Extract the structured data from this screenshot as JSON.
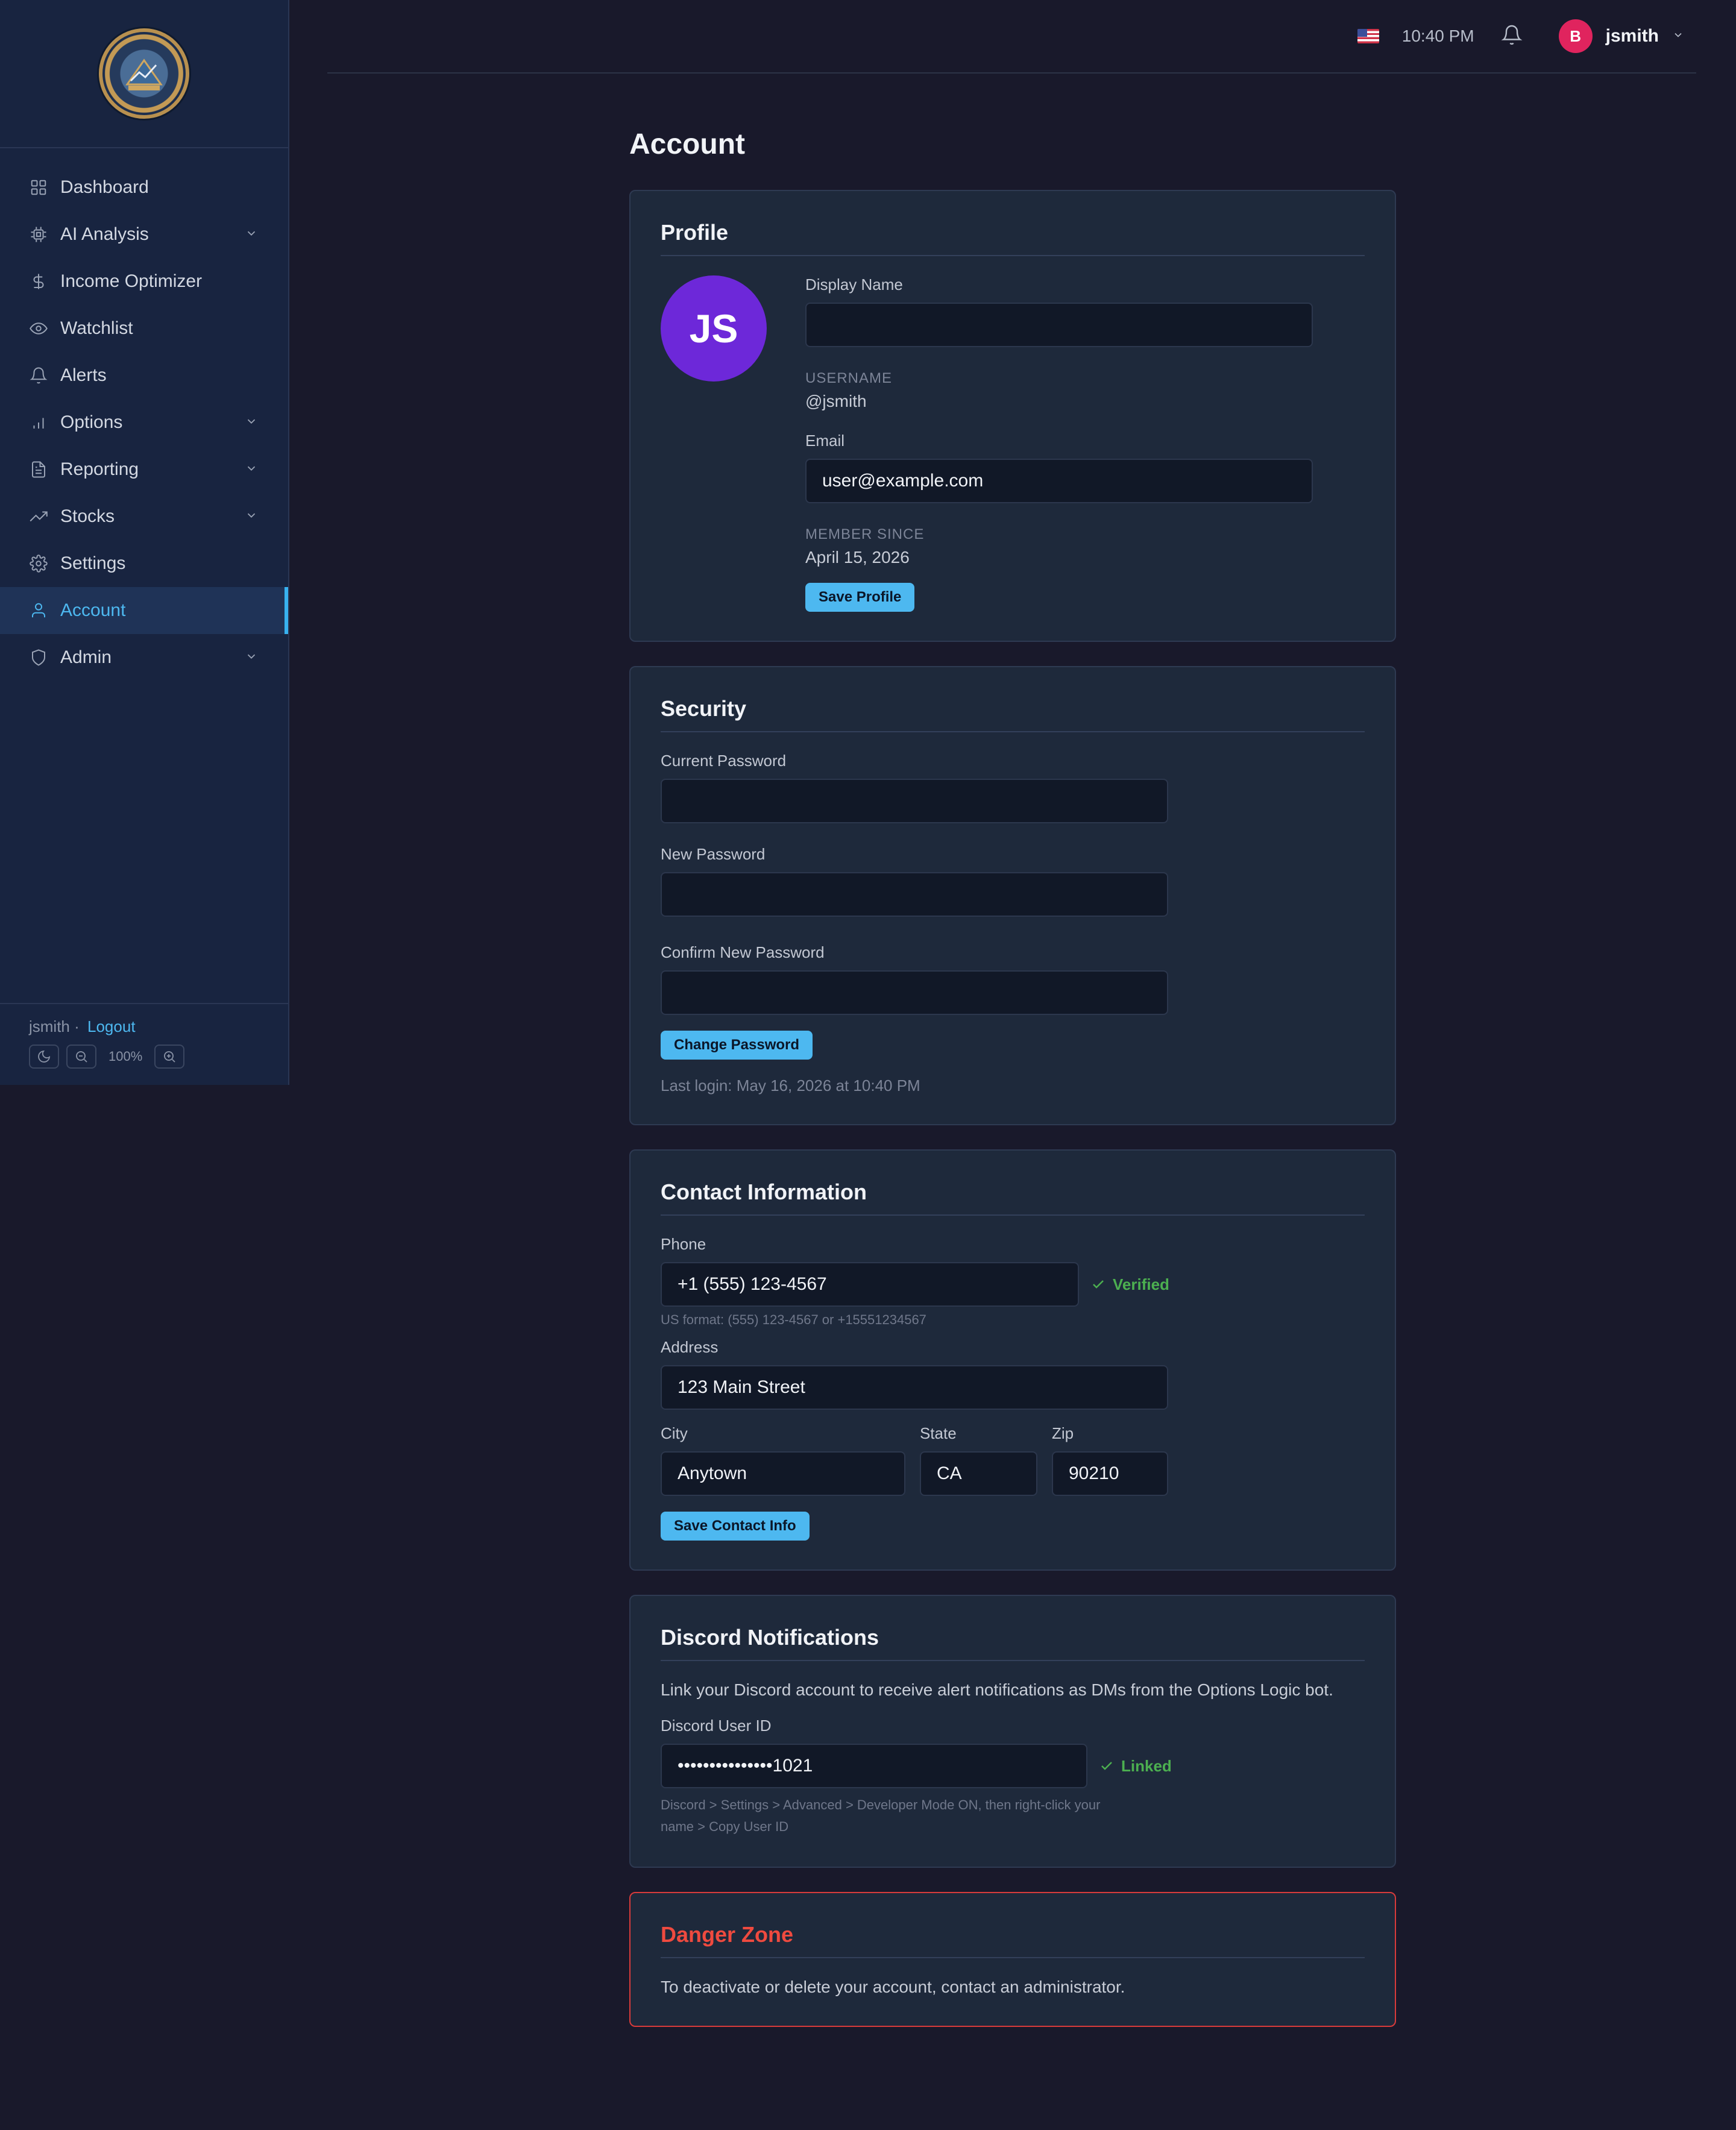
{
  "sidebar": {
    "logo_text": [
      "OPTIONS ANALYTICS PLATFORM",
      "OPTIONS LOGIC",
      "SECURE GROWTH"
    ],
    "items": [
      {
        "label": "Dashboard",
        "icon": "grid-icon",
        "has_children": false
      },
      {
        "label": "AI Analysis",
        "icon": "chip-icon",
        "has_children": true
      },
      {
        "label": "Income Optimizer",
        "icon": "dollar-icon",
        "has_children": false
      },
      {
        "label": "Watchlist",
        "icon": "eye-icon",
        "has_children": false
      },
      {
        "label": "Alerts",
        "icon": "bell-icon",
        "has_children": false
      },
      {
        "label": "Options",
        "icon": "bar-chart-icon",
        "has_children": true
      },
      {
        "label": "Reporting",
        "icon": "document-icon",
        "has_children": true
      },
      {
        "label": "Stocks",
        "icon": "trending-up-icon",
        "has_children": true
      },
      {
        "label": "Settings",
        "icon": "gear-icon",
        "has_children": false
      },
      {
        "label": "Account",
        "icon": "user-icon",
        "has_children": false,
        "active": true
      },
      {
        "label": "Admin",
        "icon": "shield-icon",
        "has_children": true
      }
    ],
    "footer": {
      "username": "jsmith ·",
      "logout_label": "Logout",
      "zoom": "100%"
    }
  },
  "topbar": {
    "time": "10:40 PM",
    "avatar_initial": "B",
    "username": "jsmith"
  },
  "page": {
    "title": "Account"
  },
  "profile": {
    "heading": "Profile",
    "avatar_initials": "JS",
    "display_name_label": "Display Name",
    "display_name_value": "",
    "username_label": "USERNAME",
    "username_value": "@jsmith",
    "email_label": "Email",
    "email_value": "user@example.com",
    "member_since_label": "MEMBER SINCE",
    "member_since_value": "April 15, 2026",
    "save_label": "Save Profile"
  },
  "security": {
    "heading": "Security",
    "current_password_label": "Current Password",
    "new_password_label": "New Password",
    "confirm_password_label": "Confirm New Password",
    "change_label": "Change Password",
    "last_login": "Last login: May 16, 2026 at 10:40 PM"
  },
  "contact": {
    "heading": "Contact Information",
    "phone_label": "Phone",
    "phone_value": "+1 (555) 123-4567",
    "phone_status": "Verified",
    "phone_hint": "US format: (555) 123-4567 or +15551234567",
    "address_label": "Address",
    "address_value": "123 Main Street",
    "city_label": "City",
    "city_value": "Anytown",
    "state_label": "State",
    "state_value": "CA",
    "zip_label": "Zip",
    "zip_value": "90210",
    "save_label": "Save Contact Info"
  },
  "discord": {
    "heading": "Discord Notifications",
    "description": "Link your Discord account to receive alert notifications as DMs from the Options Logic bot.",
    "user_id_label": "Discord User ID",
    "user_id_value": "•••••••••••••••1021",
    "status": "Linked",
    "hint_line1": "Discord > Settings > Advanced > Developer Mode ON, then right-click your",
    "hint_line2": "name > Copy User ID"
  },
  "danger": {
    "heading": "Danger Zone",
    "text": "To deactivate or delete your account, contact an administrator."
  },
  "colors": {
    "accent": "#4db8f0",
    "background": "#19192b",
    "sidebar": "#182440",
    "card": "#1e293b",
    "success": "#4caf50",
    "danger": "#ef4a3f",
    "profile_avatar": "#6d28d9",
    "user_avatar": "#e0245e"
  }
}
